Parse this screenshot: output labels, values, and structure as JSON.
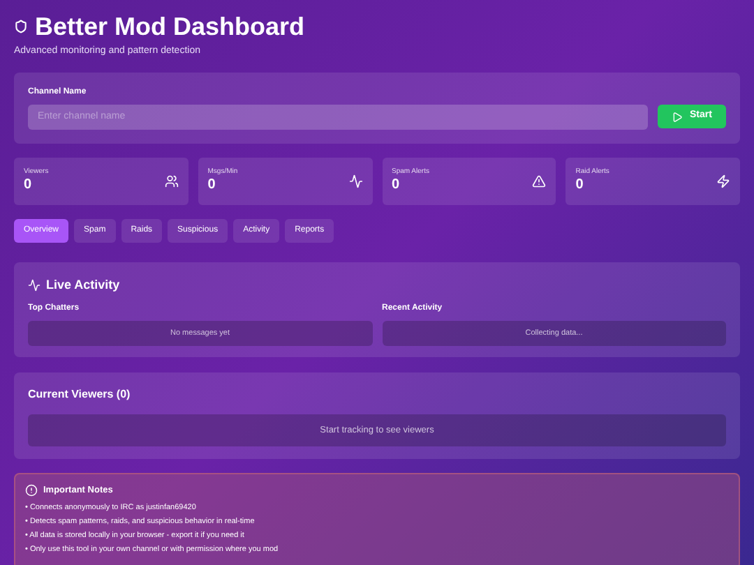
{
  "header": {
    "title": "Better Mod Dashboard",
    "subtitle": "Advanced monitoring and pattern detection"
  },
  "channel": {
    "label": "Channel Name",
    "placeholder": "Enter channel name",
    "button": "Start"
  },
  "stats": [
    {
      "label": "Viewers",
      "value": "0",
      "kind": "users"
    },
    {
      "label": "Msgs/Min",
      "value": "0",
      "kind": "activity"
    },
    {
      "label": "Spam Alerts",
      "value": "0",
      "kind": "alert"
    },
    {
      "label": "Raid Alerts",
      "value": "0",
      "kind": "zap"
    }
  ],
  "tabs": [
    {
      "label": "Overview",
      "selected": true
    },
    {
      "label": "Spam",
      "selected": false
    },
    {
      "label": "Raids",
      "selected": false
    },
    {
      "label": "Suspicious",
      "selected": false
    },
    {
      "label": "Activity",
      "selected": false
    },
    {
      "label": "Reports",
      "selected": false
    }
  ],
  "live_activity": {
    "title": "Live Activity",
    "columns": [
      {
        "heading": "Top Chatters",
        "empty": "No messages yet"
      },
      {
        "heading": "Recent Activity",
        "empty": "Collecting data..."
      }
    ]
  },
  "viewers": {
    "title": "Current Viewers (0)",
    "empty": "Start tracking to see viewers"
  },
  "notes": {
    "title": "Important Notes",
    "items": [
      "• Connects anonymously to IRC as justinfan69420",
      "• Detects spam patterns, raids, and suspicious behavior in real-time",
      "• All data is stored locally in your browser - export it if you need it",
      "• Only use this tool in your own channel or with permission where you mod"
    ]
  }
}
